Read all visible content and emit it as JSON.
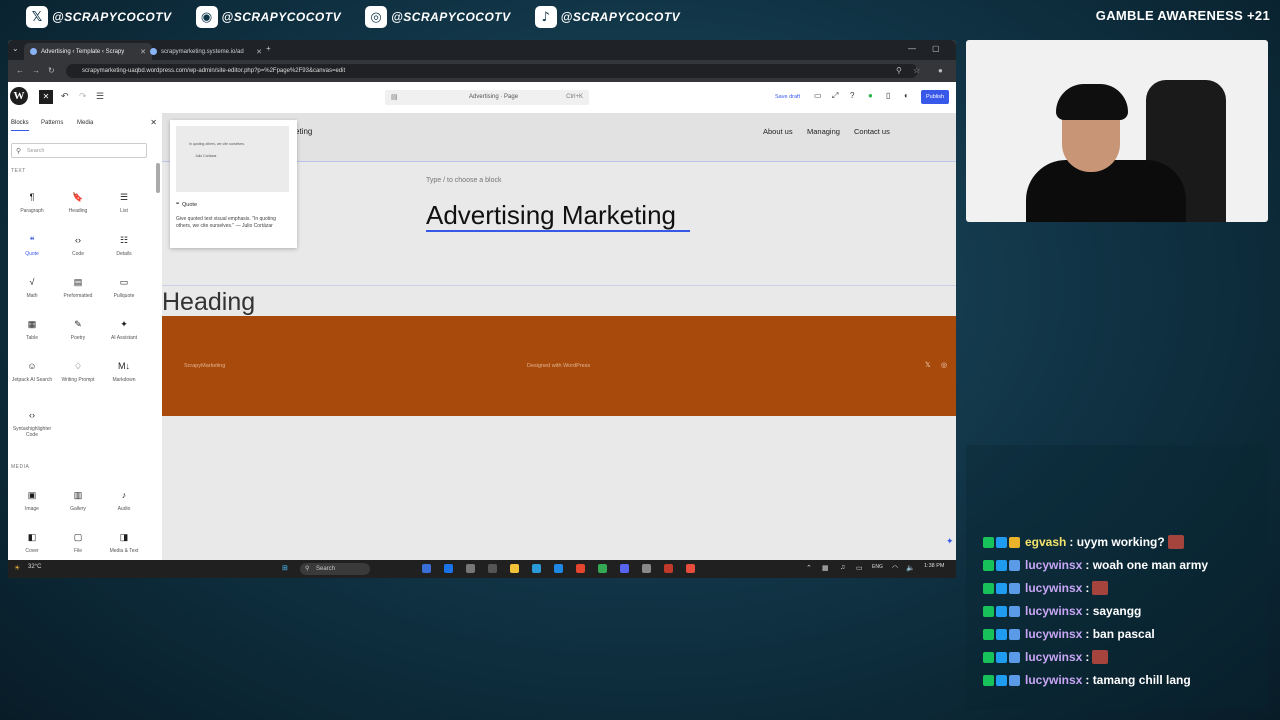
{
  "stream": {
    "socials": [
      {
        "icon": "twitter-icon",
        "glyph": "𝕏",
        "handle": "@SCRAPYCOCOTV"
      },
      {
        "icon": "discord-icon",
        "glyph": "◉",
        "handle": "@SCRAPYCOCOTV"
      },
      {
        "icon": "instagram-icon",
        "glyph": "◎",
        "handle": "@SCRAPYCOCOTV"
      },
      {
        "icon": "tiktok-icon",
        "glyph": "♪",
        "handle": "@SCRAPYCOCOTV"
      }
    ],
    "gamble_notice": "GAMBLE AWARENESS +21"
  },
  "browser": {
    "tabs": [
      {
        "label": "Advertising ‹ Template ‹ Scrapy",
        "active": true
      },
      {
        "label": "scrapymarketing.systeme.io/ad",
        "active": false
      }
    ],
    "url": "scrapymarketing-uaqbd.wordpress.com/wp-admin/site-editor.php?p=%2Fpage%2F93&canvas=edit"
  },
  "wp": {
    "command_bar": {
      "title": "Advertising · Page",
      "shortcut": "Ctrl+K"
    },
    "save_draft": "Save draft",
    "publish": "Publish",
    "sidebar": {
      "tabs": [
        "Blocks",
        "Patterns",
        "Media"
      ],
      "search_placeholder": "Search",
      "section_text": "TEXT",
      "section_media": "MEDIA",
      "blocks": [
        {
          "label": "Paragraph",
          "icon": "¶"
        },
        {
          "label": "Heading",
          "icon": "🔖"
        },
        {
          "label": "List",
          "icon": "☰"
        },
        {
          "label": "Quote",
          "icon": "❝"
        },
        {
          "label": "Code",
          "icon": "‹›"
        },
        {
          "label": "Details",
          "icon": "☷"
        },
        {
          "label": "Math",
          "icon": "√"
        },
        {
          "label": "Preformatted",
          "icon": "▤"
        },
        {
          "label": "Pullquote",
          "icon": "▭"
        },
        {
          "label": "Table",
          "icon": "▦"
        },
        {
          "label": "Poetry",
          "icon": "✎"
        },
        {
          "label": "AI Assistant",
          "icon": "✦"
        },
        {
          "label": "Jetpack AI Search",
          "icon": "☺"
        },
        {
          "label": "Writing Prompt",
          "icon": "♢"
        },
        {
          "label": "Markdown",
          "icon": "M↓"
        },
        {
          "label": "Syntaxhighlighter Code",
          "icon": "‹›"
        },
        {
          "label": "Image",
          "icon": "▣"
        },
        {
          "label": "Gallery",
          "icon": "▥"
        },
        {
          "label": "Audio",
          "icon": "♪"
        },
        {
          "label": "Cover",
          "icon": "◧"
        },
        {
          "label": "File",
          "icon": "▢"
        },
        {
          "label": "Media & Text",
          "icon": "◨"
        }
      ]
    },
    "canvas": {
      "site_title_partial": "eting",
      "nav": [
        "About us",
        "Managing",
        "Contact us"
      ],
      "type_hint": "Type / to choose a block",
      "page_title": "Advertising Marketing",
      "heading": "Heading",
      "footer_left": "ScrapyMarketing",
      "footer_mid": "Designed with WordPress"
    },
    "preview": {
      "quote": "In quoting others, we cite ourselves.",
      "author": "Julio Cortázar",
      "title": "Quote",
      "description": "Give quoted text visual emphasis. \"In quoting others, we cite ourselves.\" — Julio Cortázar"
    }
  },
  "taskbar": {
    "weather": "32°C",
    "search": "Search",
    "lang": "ENG",
    "time": "1:38 PM"
  },
  "chat": [
    {
      "user": "egvash",
      "color": "#f4e36a",
      "message": ": uyym working?",
      "emote": true,
      "badge3": "b3"
    },
    {
      "user": "lucywinsx",
      "color": "#c8a6f5",
      "message": ": woah one man army",
      "emote": false,
      "badge3": "b4"
    },
    {
      "user": "lucywinsx",
      "color": "#c8a6f5",
      "message": ":",
      "emote": true,
      "badge3": "b4"
    },
    {
      "user": "lucywinsx",
      "color": "#c8a6f5",
      "message": ": sayangg",
      "emote": false,
      "badge3": "b4"
    },
    {
      "user": "lucywinsx",
      "color": "#c8a6f5",
      "message": ": ban pascal",
      "emote": false,
      "badge3": "b4"
    },
    {
      "user": "lucywinsx",
      "color": "#c8a6f5",
      "message": ":",
      "emote": true,
      "badge3": "b4"
    },
    {
      "user": "lucywinsx",
      "color": "#c8a6f5",
      "message": ": tamang chill lang",
      "emote": false,
      "badge3": "b4"
    }
  ]
}
